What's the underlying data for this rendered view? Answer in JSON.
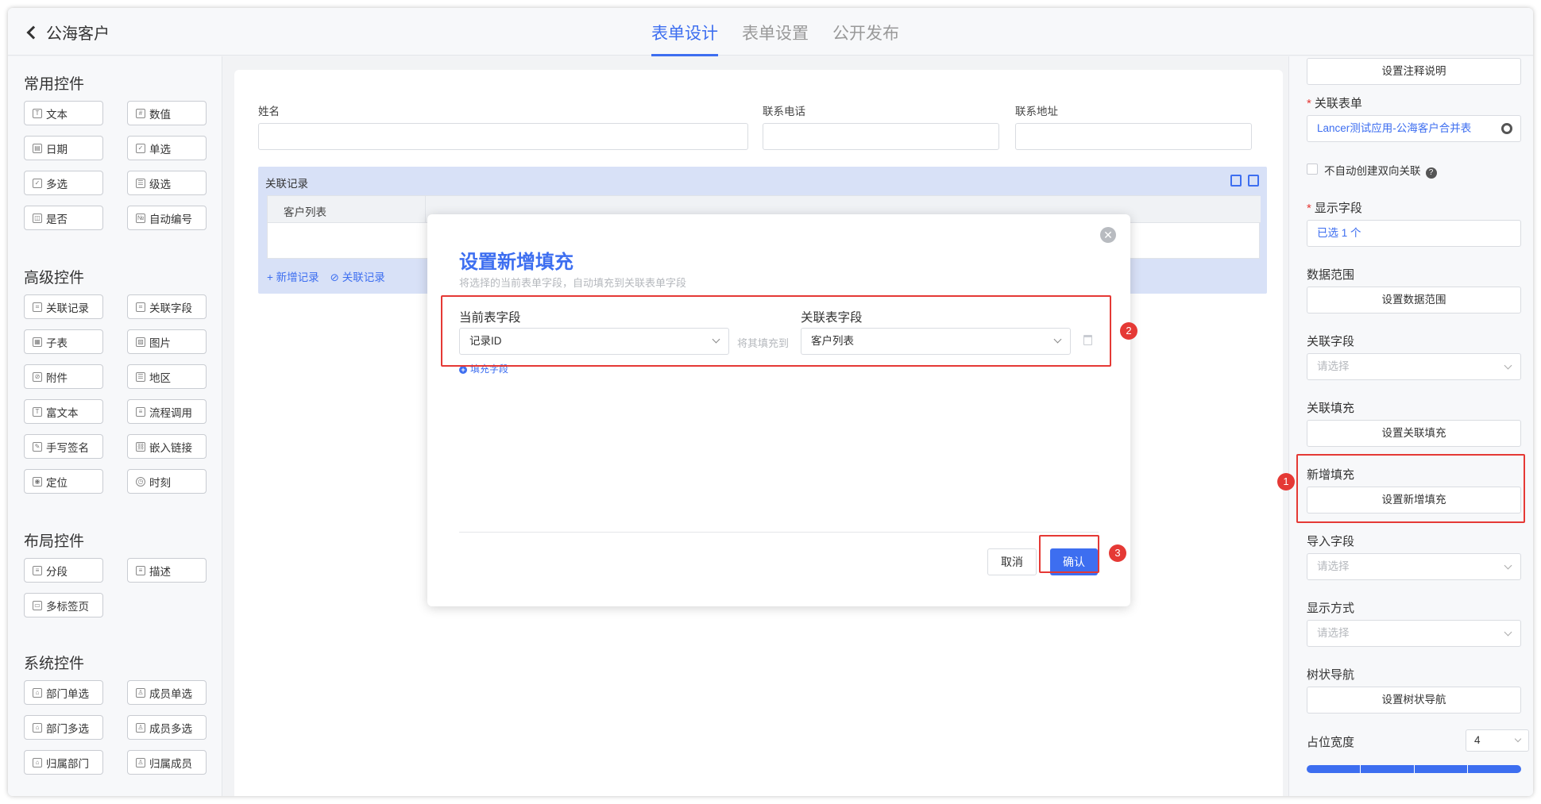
{
  "header": {
    "back_title": "公海客户",
    "tabs": [
      "表单设计",
      "表单设置",
      "公开发布"
    ]
  },
  "left_panel": {
    "sections": [
      {
        "title": "常用控件",
        "items": [
          "文本",
          "数值",
          "日期",
          "单选",
          "多选",
          "级选",
          "是否",
          "自动编号"
        ]
      },
      {
        "title": "高级控件",
        "items": [
          "关联记录",
          "关联字段",
          "子表",
          "图片",
          "附件",
          "地区",
          "富文本",
          "流程调用",
          "手写签名",
          "嵌入链接",
          "定位",
          "时刻"
        ]
      },
      {
        "title": "布局控件",
        "items": [
          "分段",
          "描述",
          "多标签页"
        ]
      },
      {
        "title": "系统控件",
        "items": [
          "部门单选",
          "成员单选",
          "部门多选",
          "成员多选",
          "归属部门",
          "归属成员"
        ]
      }
    ]
  },
  "canvas": {
    "fields": [
      {
        "label": "姓名"
      },
      {
        "label": "联系电话"
      },
      {
        "label": "联系地址"
      }
    ],
    "related": {
      "title": "关联记录",
      "column": "客户列表",
      "add_link": "+ 新增记录",
      "link_link": "关联记录"
    }
  },
  "modal": {
    "title": "设置新增填充",
    "subtitle": "将选择的当前表单字段，自动填充到关联表单字段",
    "col_current": "当前表字段",
    "col_related": "关联表字段",
    "current_value": "记录ID",
    "fill_to": "将其填充到",
    "related_value": "客户列表",
    "add_field": "填充字段",
    "cancel": "取消",
    "confirm": "确认"
  },
  "right_panel": {
    "top_button": "设置注释说明",
    "rel_form_label": "关联表单",
    "rel_form_value": "Lancer测试应用-公海客户合并表",
    "no_bidir": "不自动创建双向关联",
    "display_label": "显示字段",
    "display_value": "已选 1 个",
    "range_label": "数据范围",
    "range_button": "设置数据范围",
    "relfield_label": "关联字段",
    "relfield_placeholder": "请选择",
    "relfill_label": "关联填充",
    "relfill_button": "设置关联填充",
    "newfill_label": "新增填充",
    "newfill_button": "设置新增填充",
    "import_label": "导入字段",
    "import_placeholder": "请选择",
    "display_mode_label": "显示方式",
    "display_mode_placeholder": "请选择",
    "tree_label": "树状导航",
    "tree_button": "设置树状导航",
    "width_label": "占位宽度",
    "width_value": "4",
    "required_mark": "*"
  },
  "markers": [
    "1",
    "2",
    "3"
  ],
  "colors": {
    "accent": "#3d6ef0",
    "annotation": "#e53935"
  }
}
